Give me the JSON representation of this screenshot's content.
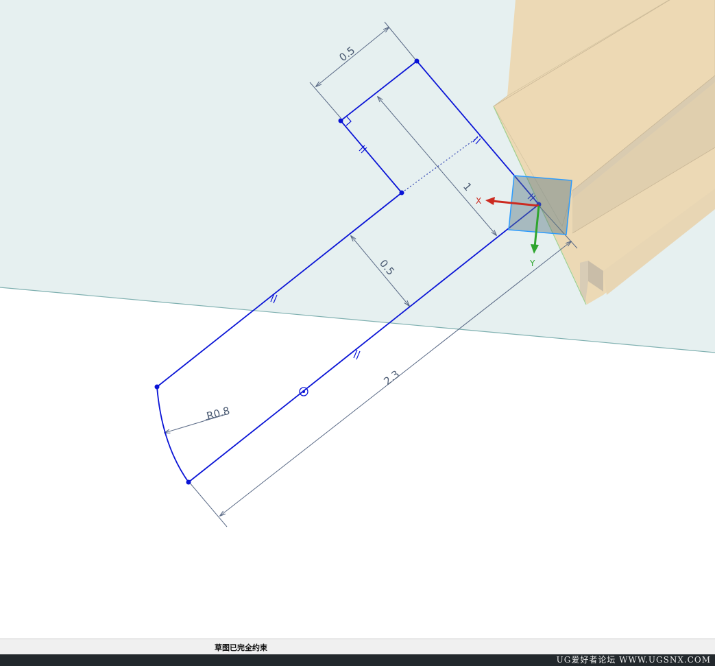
{
  "viewport": {
    "dimensions": {
      "width": "0.5",
      "height": "0.5",
      "length": "2.3",
      "radius": "R0.8",
      "vertical": "1"
    },
    "axis_labels": {
      "x": "X",
      "y": "Y"
    },
    "colors": {
      "sketch_line": "#0a14d6",
      "dimension": "#5a6a86",
      "plane": "#e6f0f0",
      "solid_body": "#ecd9b5",
      "x_axis": "#cc2a20",
      "y_axis": "#2ea52e"
    }
  },
  "status_bar": {
    "message": "草图已完全约束"
  },
  "watermark": "UG爱好者论坛 WWW.UGSNX.COM"
}
